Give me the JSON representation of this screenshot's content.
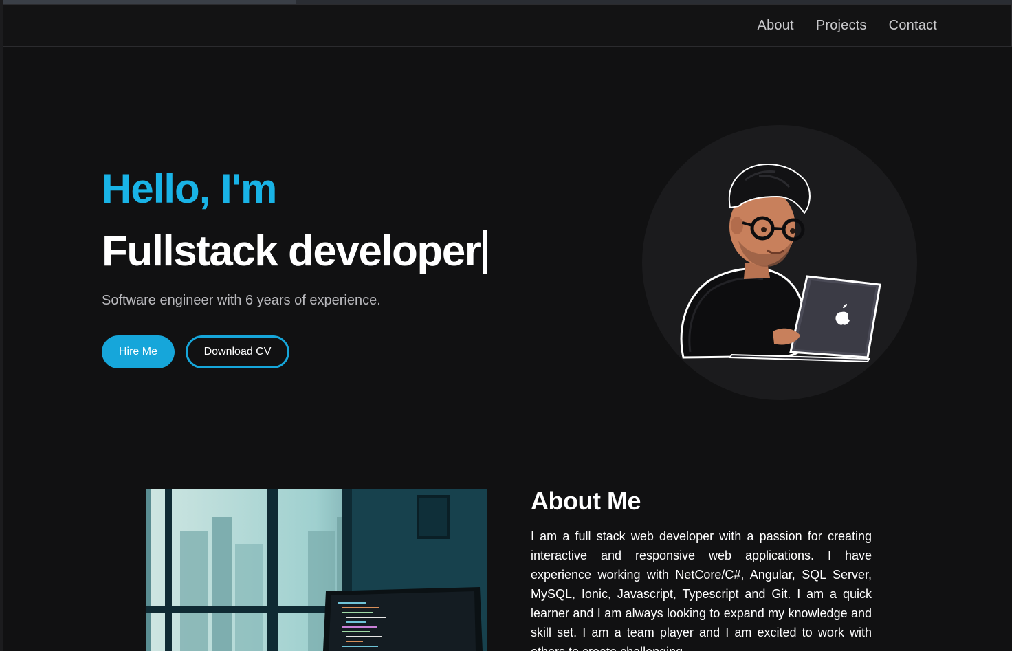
{
  "nav": {
    "links": [
      "About",
      "Projects",
      "Contact"
    ]
  },
  "hero": {
    "greeting": "Hello, I'm",
    "role": "Fullstack developer",
    "subtitle": "Software engineer with 6 years of experience.",
    "hire_label": "Hire Me",
    "cv_label": "Download CV"
  },
  "about": {
    "title": "About Me",
    "text": "I am a full stack web developer with a passion for creating interactive and responsive web applications. I have experience working with NetCore/C#, Angular, SQL Server, MySQL, Ionic, Javascript, Typescript and Git. I am a quick learner and I am always looking to expand my knowledge and skill set. I am a team player and I am excited to work with others to create challenging"
  },
  "colors": {
    "accent": "#16a6da",
    "background": "#111112"
  },
  "icons": [
    "avatar-illustration",
    "laptop-apple-icon",
    "city-window-photo"
  ]
}
